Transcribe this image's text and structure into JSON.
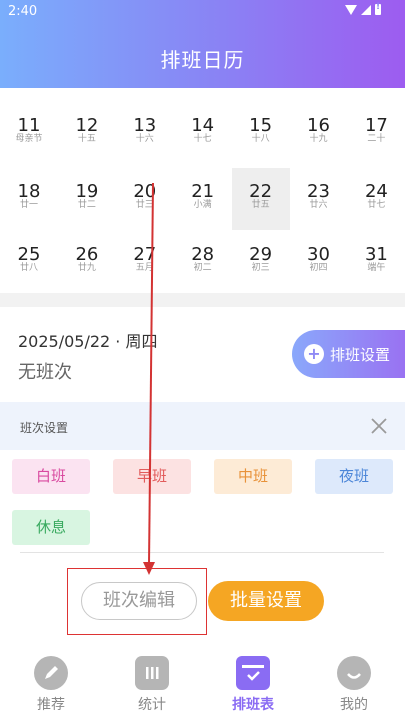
{
  "status_bar": {
    "time": "2:40"
  },
  "header": {
    "title": "排班日历"
  },
  "calendar": {
    "selected_day": "22",
    "rows": [
      [
        {
          "d": "11",
          "l": "母亲节"
        },
        {
          "d": "12",
          "l": "十五"
        },
        {
          "d": "13",
          "l": "十六"
        },
        {
          "d": "14",
          "l": "十七"
        },
        {
          "d": "15",
          "l": "十八"
        },
        {
          "d": "16",
          "l": "十九"
        },
        {
          "d": "17",
          "l": "二十"
        }
      ],
      [
        {
          "d": "18",
          "l": "廿一"
        },
        {
          "d": "19",
          "l": "廿二"
        },
        {
          "d": "20",
          "l": "廿三"
        },
        {
          "d": "21",
          "l": "小满"
        },
        {
          "d": "22",
          "l": "廿五"
        },
        {
          "d": "23",
          "l": "廿六"
        },
        {
          "d": "24",
          "l": "廿七"
        }
      ],
      [
        {
          "d": "25",
          "l": "廿八"
        },
        {
          "d": "26",
          "l": "廿九"
        },
        {
          "d": "27",
          "l": "五月"
        },
        {
          "d": "28",
          "l": "初二"
        },
        {
          "d": "29",
          "l": "初三"
        },
        {
          "d": "30",
          "l": "初四"
        },
        {
          "d": "31",
          "l": "端午"
        }
      ]
    ]
  },
  "detail": {
    "date": "2025/05/22 · 周四",
    "shift": "无班次",
    "settings_button": "排班设置"
  },
  "panel": {
    "title": "班次设置",
    "chips": [
      {
        "label": "白班",
        "bg": "#fbe3f1",
        "fg": "#d94aa0"
      },
      {
        "label": "早班",
        "bg": "#fce2e2",
        "fg": "#e25b5b"
      },
      {
        "label": "中班",
        "bg": "#fdebd6",
        "fg": "#e8923a"
      },
      {
        "label": "夜班",
        "bg": "#dde9fb",
        "fg": "#4c86d8"
      },
      {
        "label": "休息",
        "bg": "#d8f5e1",
        "fg": "#3aaa60"
      }
    ]
  },
  "actions": {
    "edit_label": "班次编辑",
    "batch_label": "批量设置"
  },
  "tabs": [
    {
      "label": "推荐",
      "icon": "pen-icon"
    },
    {
      "label": "统计",
      "icon": "chart-icon"
    },
    {
      "label": "排班表",
      "icon": "calendar-check-icon"
    },
    {
      "label": "我的",
      "icon": "smile-icon"
    }
  ],
  "colors": {
    "accent": "#8a6cf3",
    "batch": "#f5a623",
    "annotation": "#d33333"
  }
}
